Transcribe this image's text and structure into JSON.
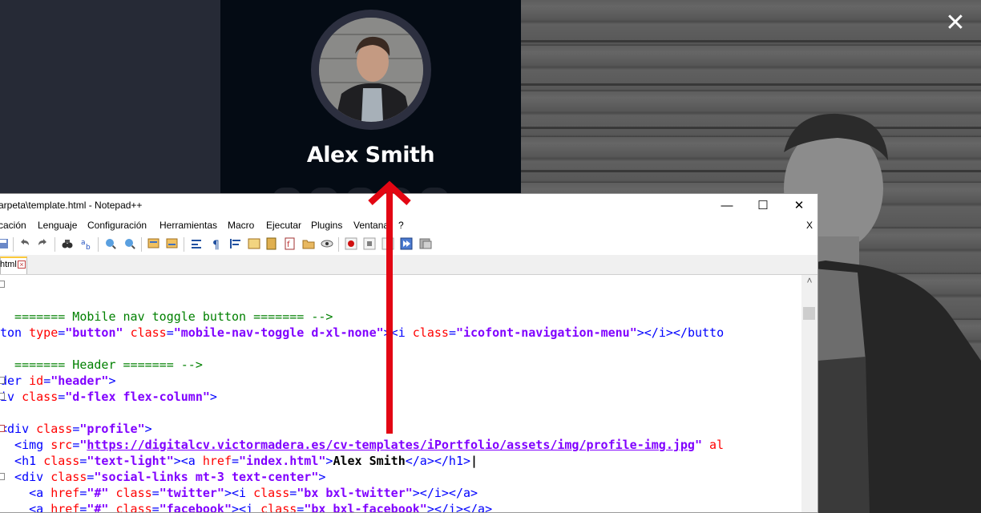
{
  "profile": {
    "name": "Alex Smith"
  },
  "close_symbol": "✕",
  "window": {
    "title": "arpeta\\template.html - Notepad++",
    "minimize_symbol": "—",
    "maximize_symbol": "☐",
    "close_symbol": "✕"
  },
  "menu": {
    "items": [
      "cación",
      "Lenguaje",
      "Configuración",
      "Herramientas",
      "Macro",
      "Ejecutar",
      "Plugins",
      "Ventana",
      "?"
    ],
    "close_label": "X"
  },
  "tab": {
    "label": "html",
    "close_symbol": "×"
  },
  "scrollbar": {
    "up_symbol": "˄"
  },
  "code": {
    "line_1": [
      {
        "cls": "t-comment",
        "text": "  ======= Mobile nav toggle button ======= -->"
      }
    ],
    "line_2": [
      {
        "cls": "t-tag",
        "text": "ton "
      },
      {
        "cls": "t-attr",
        "text": "type"
      },
      {
        "cls": "t-tag",
        "text": "="
      },
      {
        "cls": "t-str",
        "text": "\"button\""
      },
      {
        "cls": "t-tag",
        "text": " "
      },
      {
        "cls": "t-attr",
        "text": "class"
      },
      {
        "cls": "t-tag",
        "text": "="
      },
      {
        "cls": "t-str",
        "text": "\"mobile-nav-toggle d-xl-none\""
      },
      {
        "cls": "t-tag",
        "text": "><i "
      },
      {
        "cls": "t-attr",
        "text": "class"
      },
      {
        "cls": "t-tag",
        "text": "="
      },
      {
        "cls": "t-str",
        "text": "\"icofont-navigation-menu\""
      },
      {
        "cls": "t-tag",
        "text": "></i></butto"
      }
    ],
    "line_3": [],
    "line_4": [
      {
        "cls": "t-comment",
        "text": "  ======= Header ======= -->"
      }
    ],
    "line_5": [
      {
        "cls": "t-tag",
        "text": "der "
      },
      {
        "cls": "t-attr",
        "text": "id"
      },
      {
        "cls": "t-tag",
        "text": "="
      },
      {
        "cls": "t-str",
        "text": "\"header\""
      },
      {
        "cls": "t-tag",
        "text": ">"
      }
    ],
    "line_6": [
      {
        "cls": "t-tag",
        "text": "iv "
      },
      {
        "cls": "t-attr",
        "text": "class"
      },
      {
        "cls": "t-tag",
        "text": "="
      },
      {
        "cls": "t-str",
        "text": "\"d-flex flex-column\""
      },
      {
        "cls": "t-tag",
        "text": ">"
      }
    ],
    "line_7": [],
    "line_8": [
      {
        "cls": "t-tag",
        "text": "<div "
      },
      {
        "cls": "t-attr",
        "text": "class"
      },
      {
        "cls": "t-tag",
        "text": "="
      },
      {
        "cls": "t-str",
        "text": "\"profile\""
      },
      {
        "cls": "t-tag",
        "text": ">"
      }
    ],
    "line_9": [
      {
        "cls": "t-tag",
        "text": "  <img "
      },
      {
        "cls": "t-attr",
        "text": "src"
      },
      {
        "cls": "t-tag",
        "text": "="
      },
      {
        "cls": "t-str",
        "text": "\""
      },
      {
        "cls": "t-link",
        "text": "https://digitalcv.victormadera.es/cv-templates/iPortfolio/assets/img/profile-img.jpg"
      },
      {
        "cls": "t-str",
        "text": "\""
      },
      {
        "cls": "t-tag",
        "text": " "
      },
      {
        "cls": "t-attr",
        "text": "al"
      }
    ],
    "line_10": [
      {
        "cls": "t-tag",
        "text": "  <h1 "
      },
      {
        "cls": "t-attr",
        "text": "class"
      },
      {
        "cls": "t-tag",
        "text": "="
      },
      {
        "cls": "t-str",
        "text": "\"text-light\""
      },
      {
        "cls": "t-tag",
        "text": "><a "
      },
      {
        "cls": "t-attr",
        "text": "href"
      },
      {
        "cls": "t-tag",
        "text": "="
      },
      {
        "cls": "t-str",
        "text": "\"index.html\""
      },
      {
        "cls": "t-tag",
        "text": ">"
      },
      {
        "cls": "t-text",
        "text": "Alex Smith"
      },
      {
        "cls": "t-tag",
        "text": "</a></h1>"
      },
      {
        "cls": "t-text",
        "text": "|"
      }
    ],
    "line_11": [
      {
        "cls": "t-tag",
        "text": "  <div "
      },
      {
        "cls": "t-attr",
        "text": "class"
      },
      {
        "cls": "t-tag",
        "text": "="
      },
      {
        "cls": "t-str",
        "text": "\"social-links mt-3 text-center\""
      },
      {
        "cls": "t-tag",
        "text": ">"
      }
    ],
    "line_12": [
      {
        "cls": "t-tag",
        "text": "    <a "
      },
      {
        "cls": "t-attr",
        "text": "href"
      },
      {
        "cls": "t-tag",
        "text": "="
      },
      {
        "cls": "t-str",
        "text": "\"#\""
      },
      {
        "cls": "t-tag",
        "text": " "
      },
      {
        "cls": "t-attr",
        "text": "class"
      },
      {
        "cls": "t-tag",
        "text": "="
      },
      {
        "cls": "t-str",
        "text": "\"twitter\""
      },
      {
        "cls": "t-tag",
        "text": "><i "
      },
      {
        "cls": "t-attr",
        "text": "class"
      },
      {
        "cls": "t-tag",
        "text": "="
      },
      {
        "cls": "t-str",
        "text": "\"bx bxl-twitter\""
      },
      {
        "cls": "t-tag",
        "text": "></i></a>"
      }
    ],
    "line_13": [
      {
        "cls": "t-tag",
        "text": "    <a "
      },
      {
        "cls": "t-attr",
        "text": "href"
      },
      {
        "cls": "t-tag",
        "text": "="
      },
      {
        "cls": "t-str",
        "text": "\"#\""
      },
      {
        "cls": "t-tag",
        "text": " "
      },
      {
        "cls": "t-attr",
        "text": "class"
      },
      {
        "cls": "t-tag",
        "text": "="
      },
      {
        "cls": "t-str",
        "text": "\"facebook\""
      },
      {
        "cls": "t-tag",
        "text": "><i "
      },
      {
        "cls": "t-attr",
        "text": "class"
      },
      {
        "cls": "t-tag",
        "text": "="
      },
      {
        "cls": "t-str",
        "text": "\"bx bxl-facebook\""
      },
      {
        "cls": "t-tag",
        "text": "></i></a>"
      }
    ]
  },
  "colors": {
    "sidebar_bg": "#040b14",
    "annotation_arrow": "#e30613",
    "comment": "#008000",
    "tag": "#0000ff",
    "attribute": "#ff0000",
    "string": "#8000ff"
  }
}
